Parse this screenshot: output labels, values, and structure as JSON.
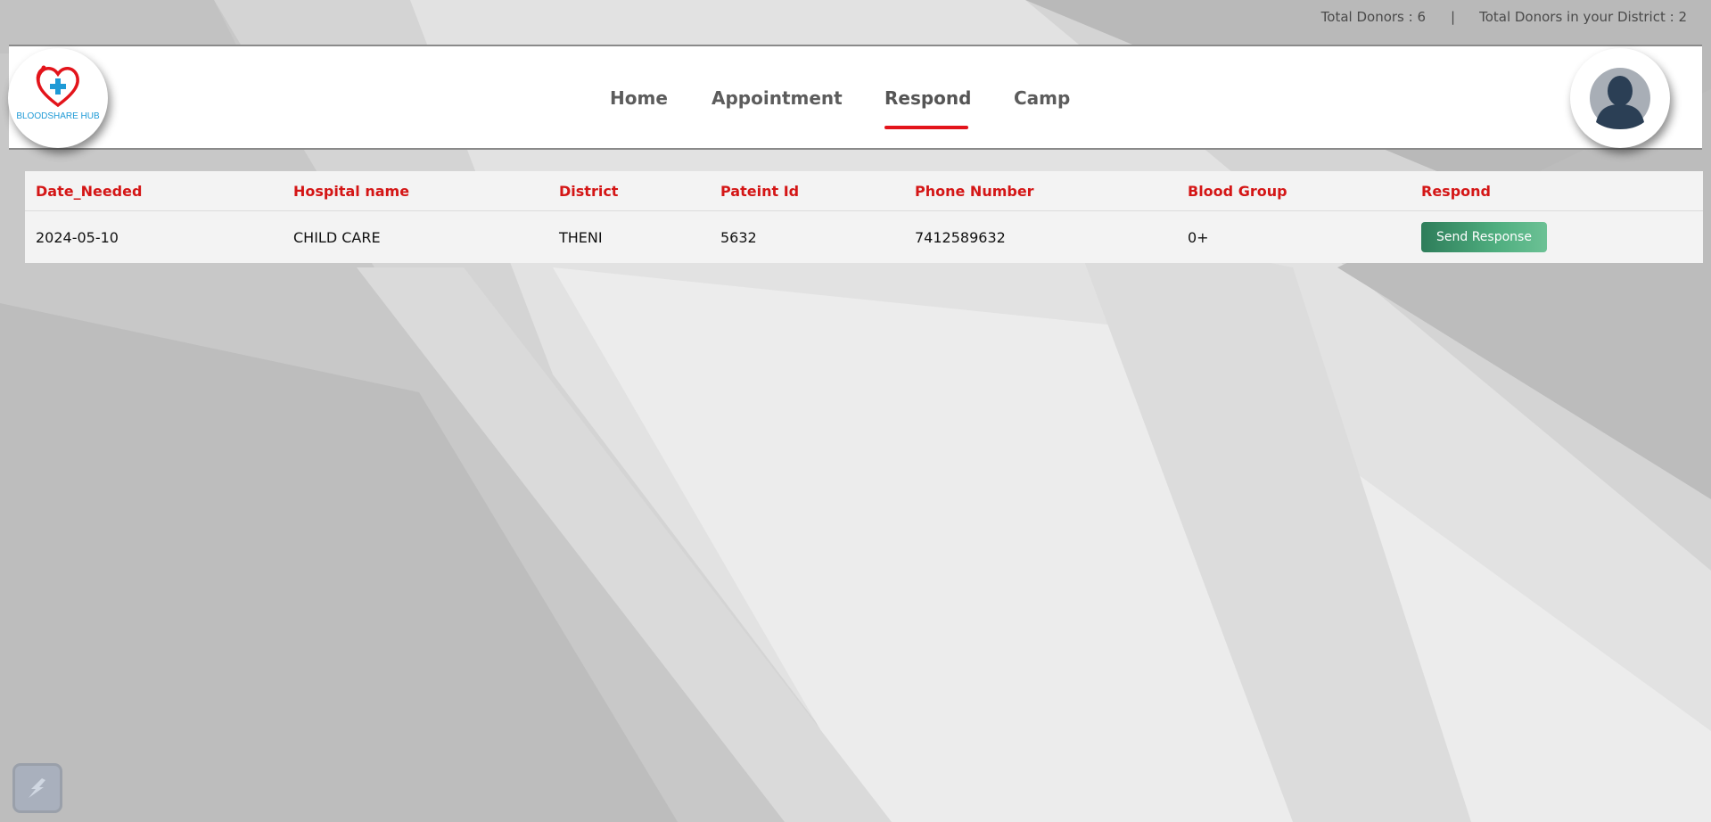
{
  "topbar": {
    "total_donors": "Total Donors : 6",
    "separator": "|",
    "district_donors": "Total Donors in your District : 2"
  },
  "brand": {
    "logo_text": "BLOODSHARE HUB",
    "logo_icon": "heart-cross-icon"
  },
  "nav": {
    "items": [
      {
        "label": "Home"
      },
      {
        "label": "Appointment"
      },
      {
        "label": "Respond",
        "active": true
      },
      {
        "label": "Camp"
      }
    ]
  },
  "user": {
    "avatar_icon": "user-avatar-icon"
  },
  "table": {
    "headers": [
      "Date_Needed",
      "Hospital name",
      "District",
      "Pateint Id",
      "Phone Number",
      "Blood Group",
      "Respond"
    ],
    "rows": [
      {
        "date_needed": "2024-05-10",
        "hospital_name": "CHILD CARE",
        "district": "THENI",
        "patient_id": "5632",
        "phone_number": "7412589632",
        "blood_group": "0+",
        "action_label": "Send Response"
      }
    ]
  },
  "colors": {
    "accent_red": "#d41616",
    "active_underline": "#e3141b",
    "button_green": "#3f9a6d"
  },
  "floating_tool": {
    "icon": "slash-tool-icon"
  }
}
